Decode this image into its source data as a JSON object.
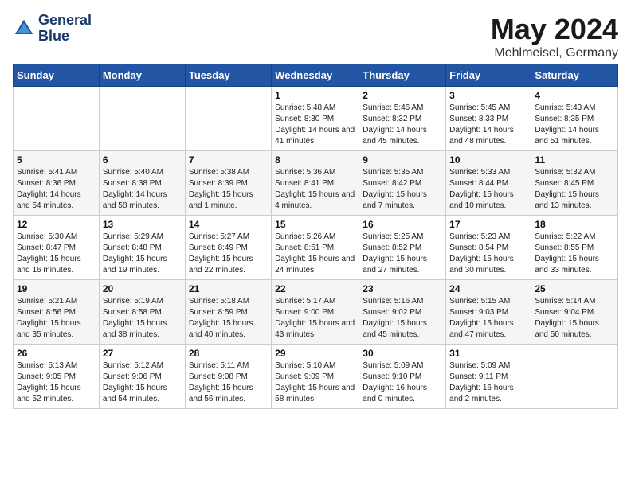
{
  "header": {
    "logo_line1": "General",
    "logo_line2": "Blue",
    "month_title": "May 2024",
    "location": "Mehlmeisel, Germany"
  },
  "weekdays": [
    "Sunday",
    "Monday",
    "Tuesday",
    "Wednesday",
    "Thursday",
    "Friday",
    "Saturday"
  ],
  "weeks": [
    [
      {
        "day": "",
        "info": ""
      },
      {
        "day": "",
        "info": ""
      },
      {
        "day": "",
        "info": ""
      },
      {
        "day": "1",
        "info": "Sunrise: 5:48 AM\nSunset: 8:30 PM\nDaylight: 14 hours and 41 minutes."
      },
      {
        "day": "2",
        "info": "Sunrise: 5:46 AM\nSunset: 8:32 PM\nDaylight: 14 hours and 45 minutes."
      },
      {
        "day": "3",
        "info": "Sunrise: 5:45 AM\nSunset: 8:33 PM\nDaylight: 14 hours and 48 minutes."
      },
      {
        "day": "4",
        "info": "Sunrise: 5:43 AM\nSunset: 8:35 PM\nDaylight: 14 hours and 51 minutes."
      }
    ],
    [
      {
        "day": "5",
        "info": "Sunrise: 5:41 AM\nSunset: 8:36 PM\nDaylight: 14 hours and 54 minutes."
      },
      {
        "day": "6",
        "info": "Sunrise: 5:40 AM\nSunset: 8:38 PM\nDaylight: 14 hours and 58 minutes."
      },
      {
        "day": "7",
        "info": "Sunrise: 5:38 AM\nSunset: 8:39 PM\nDaylight: 15 hours and 1 minute."
      },
      {
        "day": "8",
        "info": "Sunrise: 5:36 AM\nSunset: 8:41 PM\nDaylight: 15 hours and 4 minutes."
      },
      {
        "day": "9",
        "info": "Sunrise: 5:35 AM\nSunset: 8:42 PM\nDaylight: 15 hours and 7 minutes."
      },
      {
        "day": "10",
        "info": "Sunrise: 5:33 AM\nSunset: 8:44 PM\nDaylight: 15 hours and 10 minutes."
      },
      {
        "day": "11",
        "info": "Sunrise: 5:32 AM\nSunset: 8:45 PM\nDaylight: 15 hours and 13 minutes."
      }
    ],
    [
      {
        "day": "12",
        "info": "Sunrise: 5:30 AM\nSunset: 8:47 PM\nDaylight: 15 hours and 16 minutes."
      },
      {
        "day": "13",
        "info": "Sunrise: 5:29 AM\nSunset: 8:48 PM\nDaylight: 15 hours and 19 minutes."
      },
      {
        "day": "14",
        "info": "Sunrise: 5:27 AM\nSunset: 8:49 PM\nDaylight: 15 hours and 22 minutes."
      },
      {
        "day": "15",
        "info": "Sunrise: 5:26 AM\nSunset: 8:51 PM\nDaylight: 15 hours and 24 minutes."
      },
      {
        "day": "16",
        "info": "Sunrise: 5:25 AM\nSunset: 8:52 PM\nDaylight: 15 hours and 27 minutes."
      },
      {
        "day": "17",
        "info": "Sunrise: 5:23 AM\nSunset: 8:54 PM\nDaylight: 15 hours and 30 minutes."
      },
      {
        "day": "18",
        "info": "Sunrise: 5:22 AM\nSunset: 8:55 PM\nDaylight: 15 hours and 33 minutes."
      }
    ],
    [
      {
        "day": "19",
        "info": "Sunrise: 5:21 AM\nSunset: 8:56 PM\nDaylight: 15 hours and 35 minutes."
      },
      {
        "day": "20",
        "info": "Sunrise: 5:19 AM\nSunset: 8:58 PM\nDaylight: 15 hours and 38 minutes."
      },
      {
        "day": "21",
        "info": "Sunrise: 5:18 AM\nSunset: 8:59 PM\nDaylight: 15 hours and 40 minutes."
      },
      {
        "day": "22",
        "info": "Sunrise: 5:17 AM\nSunset: 9:00 PM\nDaylight: 15 hours and 43 minutes."
      },
      {
        "day": "23",
        "info": "Sunrise: 5:16 AM\nSunset: 9:02 PM\nDaylight: 15 hours and 45 minutes."
      },
      {
        "day": "24",
        "info": "Sunrise: 5:15 AM\nSunset: 9:03 PM\nDaylight: 15 hours and 47 minutes."
      },
      {
        "day": "25",
        "info": "Sunrise: 5:14 AM\nSunset: 9:04 PM\nDaylight: 15 hours and 50 minutes."
      }
    ],
    [
      {
        "day": "26",
        "info": "Sunrise: 5:13 AM\nSunset: 9:05 PM\nDaylight: 15 hours and 52 minutes."
      },
      {
        "day": "27",
        "info": "Sunrise: 5:12 AM\nSunset: 9:06 PM\nDaylight: 15 hours and 54 minutes."
      },
      {
        "day": "28",
        "info": "Sunrise: 5:11 AM\nSunset: 9:08 PM\nDaylight: 15 hours and 56 minutes."
      },
      {
        "day": "29",
        "info": "Sunrise: 5:10 AM\nSunset: 9:09 PM\nDaylight: 15 hours and 58 minutes."
      },
      {
        "day": "30",
        "info": "Sunrise: 5:09 AM\nSunset: 9:10 PM\nDaylight: 16 hours and 0 minutes."
      },
      {
        "day": "31",
        "info": "Sunrise: 5:09 AM\nSunset: 9:11 PM\nDaylight: 16 hours and 2 minutes."
      },
      {
        "day": "",
        "info": ""
      }
    ]
  ]
}
